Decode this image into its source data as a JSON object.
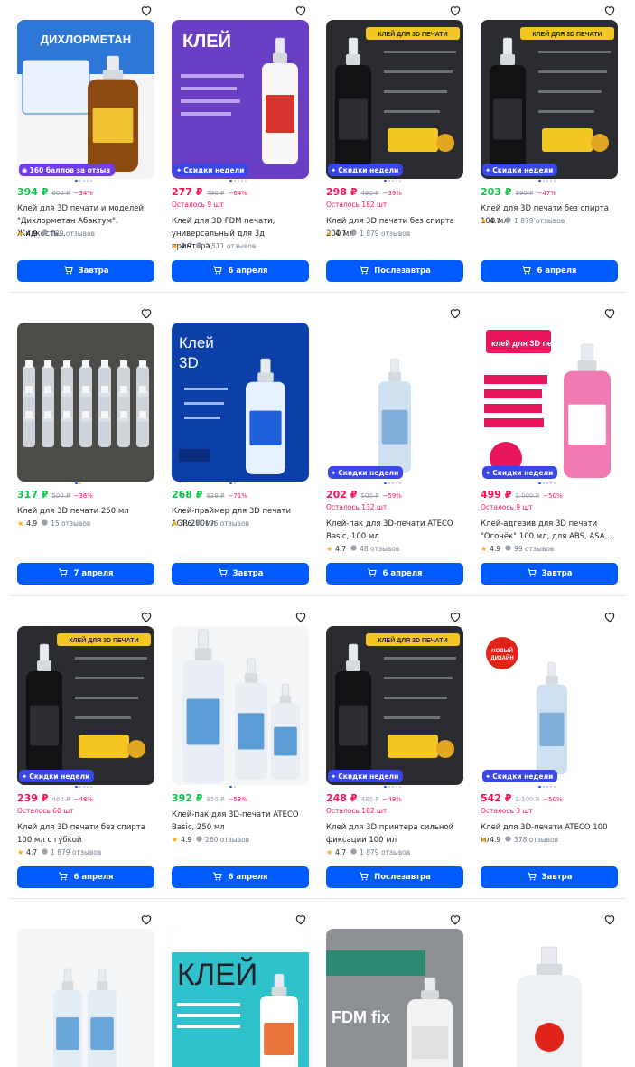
{
  "colors": {
    "accent": "#005bff",
    "green_price": "#10c44c",
    "pink_price": "#f91155",
    "badge": "#3a47e8"
  },
  "products": [
    {
      "price": "394 ₽",
      "old": "600 ₽",
      "disc": "−34%",
      "price_color": "green",
      "left": "",
      "title": "Клей для 3D печати и моделей \"Дихлорметан Абактум\". Жидкость…",
      "rating": "4.9",
      "reviews": "789 отзывов",
      "badge": "160 баллов за отзыв",
      "badge_kind": "purple",
      "button": "Завтра",
      "image_text": "ДИХЛОРМЕТАН",
      "image_kind": "bottle-brown"
    },
    {
      "price": "277 ₽",
      "old": "790 ₽",
      "disc": "−64%",
      "price_color": "pink",
      "left": "Осталось 9 шт",
      "title": "Клей для 3D FDM печати, универсальный для 3д принтера,…",
      "rating": "4.9",
      "reviews": "2 511 отзывов",
      "badge": "Скидки недели",
      "badge_kind": "blue",
      "button": "6 апреля",
      "image_text": "КЛЕЙ",
      "image_kind": "purple-poster"
    },
    {
      "price": "298 ₽",
      "old": "490 ₽",
      "disc": "−39%",
      "price_color": "pink",
      "left": "Осталось 182 шт",
      "title": "Клей для 3D печати без спирта 200 мл",
      "rating": "4.7",
      "reviews": "1 879 отзывов",
      "badge": "Скидки недели",
      "badge_kind": "blue",
      "button": "Послезавтра",
      "image_text": "КЛЕЙ ДЛЯ 3D ПЕЧАТИ",
      "image_kind": "dark-poster"
    },
    {
      "price": "203 ₽",
      "old": "390 ₽",
      "disc": "−47%",
      "price_color": "green",
      "left": "",
      "title": "Клей для 3D печати без спирта 100 мл",
      "rating": "4.7",
      "reviews": "1 879 отзывов",
      "badge": "Скидки недели",
      "badge_kind": "blue",
      "button": "6 апреля",
      "image_text": "КЛЕЙ ДЛЯ 3D ПЕЧАТИ",
      "image_kind": "dark-poster"
    },
    {
      "price": "317 ₽",
      "old": "500 ₽",
      "disc": "−36%",
      "price_color": "green",
      "left": "",
      "title": "Клей для 3D печати 250 мл",
      "rating": "4.9",
      "reviews": "15 отзывов",
      "badge": "",
      "badge_kind": "",
      "button": "7 апреля",
      "image_text": "",
      "image_kind": "photo-bottles"
    },
    {
      "price": "268 ₽",
      "old": "929 ₽",
      "disc": "−71%",
      "price_color": "green",
      "left": "",
      "title": "Клей-праймер для 3D печати AGR 200мл",
      "rating": "4.6",
      "reviews": "176 отзывов",
      "badge": "",
      "badge_kind": "",
      "button": "Завтра",
      "image_text": "Клей для 3D принтера",
      "image_kind": "blue-poster"
    },
    {
      "price": "202 ₽",
      "old": "500 ₽",
      "disc": "−59%",
      "price_color": "pink",
      "left": "Осталось 132 шт",
      "title": "Клей-пак для 3D-печати ATECO Basic, 100 мл",
      "rating": "4.7",
      "reviews": "48 отзывов",
      "badge": "Скидки недели",
      "badge_kind": "blue",
      "button": "6 апреля",
      "image_text": "",
      "image_kind": "white-bottle"
    },
    {
      "price": "499 ₽",
      "old": "1 000 ₽",
      "disc": "−50%",
      "price_color": "pink",
      "left": "Осталось 9 шт",
      "title": "Клей-адгезив для 3D печати \"Огонёк\" 100 мл, для ABS, ASA,…",
      "rating": "4.9",
      "reviews": "99 отзывов",
      "badge": "Скидки недели",
      "badge_kind": "blue",
      "button": "Завтра",
      "image_text": "клей для 3D печати",
      "image_kind": "pink-bottle"
    },
    {
      "price": "239 ₽",
      "old": "460 ₽",
      "disc": "−48%",
      "price_color": "pink",
      "left": "Осталось 60 шт",
      "title": "Клей для 3D печати без спирта 100 мл с губкой",
      "rating": "4.7",
      "reviews": "1 879 отзывов",
      "badge": "Скидки недели",
      "badge_kind": "blue",
      "button": "6 апреля",
      "image_text": "КЛЕЙ ДЛЯ 3D ПЕЧАТИ",
      "image_kind": "dark-poster"
    },
    {
      "price": "392 ₽",
      "old": "850 ₽",
      "disc": "−53%",
      "price_color": "green",
      "left": "",
      "title": "Клей-пак для 3D-печати ATECO Basic, 250 мл",
      "rating": "4.9",
      "reviews": "260 отзывов",
      "badge": "",
      "badge_kind": "",
      "button": "6 апреля",
      "image_text": "",
      "image_kind": "white-bottles"
    },
    {
      "price": "248 ₽",
      "old": "480 ₽",
      "disc": "−48%",
      "price_color": "pink",
      "left": "Осталось 182 шт",
      "title": "Клей для 3D принтера сильной фиксации 100 мл",
      "rating": "4.7",
      "reviews": "1 879 отзывов",
      "badge": "Скидки недели",
      "badge_kind": "blue",
      "button": "Послезавтра",
      "image_text": "КЛЕЙ ДЛЯ 3D ПЕЧАТИ",
      "image_kind": "dark-poster"
    },
    {
      "price": "542 ₽",
      "old": "1 100 ₽",
      "disc": "−50%",
      "price_color": "pink",
      "left": "Осталось 3 шт",
      "title": "Клей для 3D-печати ATECO 100 мл",
      "rating": "4.9",
      "reviews": "378 отзывов",
      "badge": "Скидки недели",
      "badge_kind": "blue",
      "button": "Завтра",
      "image_text": "НОВЫЙ ДИЗАЙН",
      "image_kind": "white-bottle-new"
    },
    {
      "price": "",
      "old": "",
      "disc": "",
      "price_color": "",
      "left": "",
      "title": "",
      "rating": "",
      "reviews": "",
      "badge": "",
      "badge_kind": "",
      "button": "",
      "image_text": "",
      "image_kind": "white-bottles-2"
    },
    {
      "price": "",
      "old": "",
      "disc": "",
      "price_color": "",
      "left": "",
      "title": "",
      "rating": "",
      "reviews": "",
      "badge": "",
      "badge_kind": "",
      "button": "",
      "image_text": "КЛЕЙ",
      "image_kind": "teal-poster"
    },
    {
      "price": "",
      "old": "",
      "disc": "",
      "price_color": "",
      "left": "",
      "title": "",
      "rating": "",
      "reviews": "",
      "badge": "",
      "badge_kind": "",
      "button": "",
      "image_text": "FDM fix",
      "image_kind": "grey-poster"
    },
    {
      "price": "",
      "old": "",
      "disc": "",
      "price_color": "",
      "left": "",
      "title": "",
      "rating": "",
      "reviews": "",
      "badge": "",
      "badge_kind": "",
      "button": "",
      "image_text": "",
      "image_kind": "clear-bottle"
    }
  ]
}
